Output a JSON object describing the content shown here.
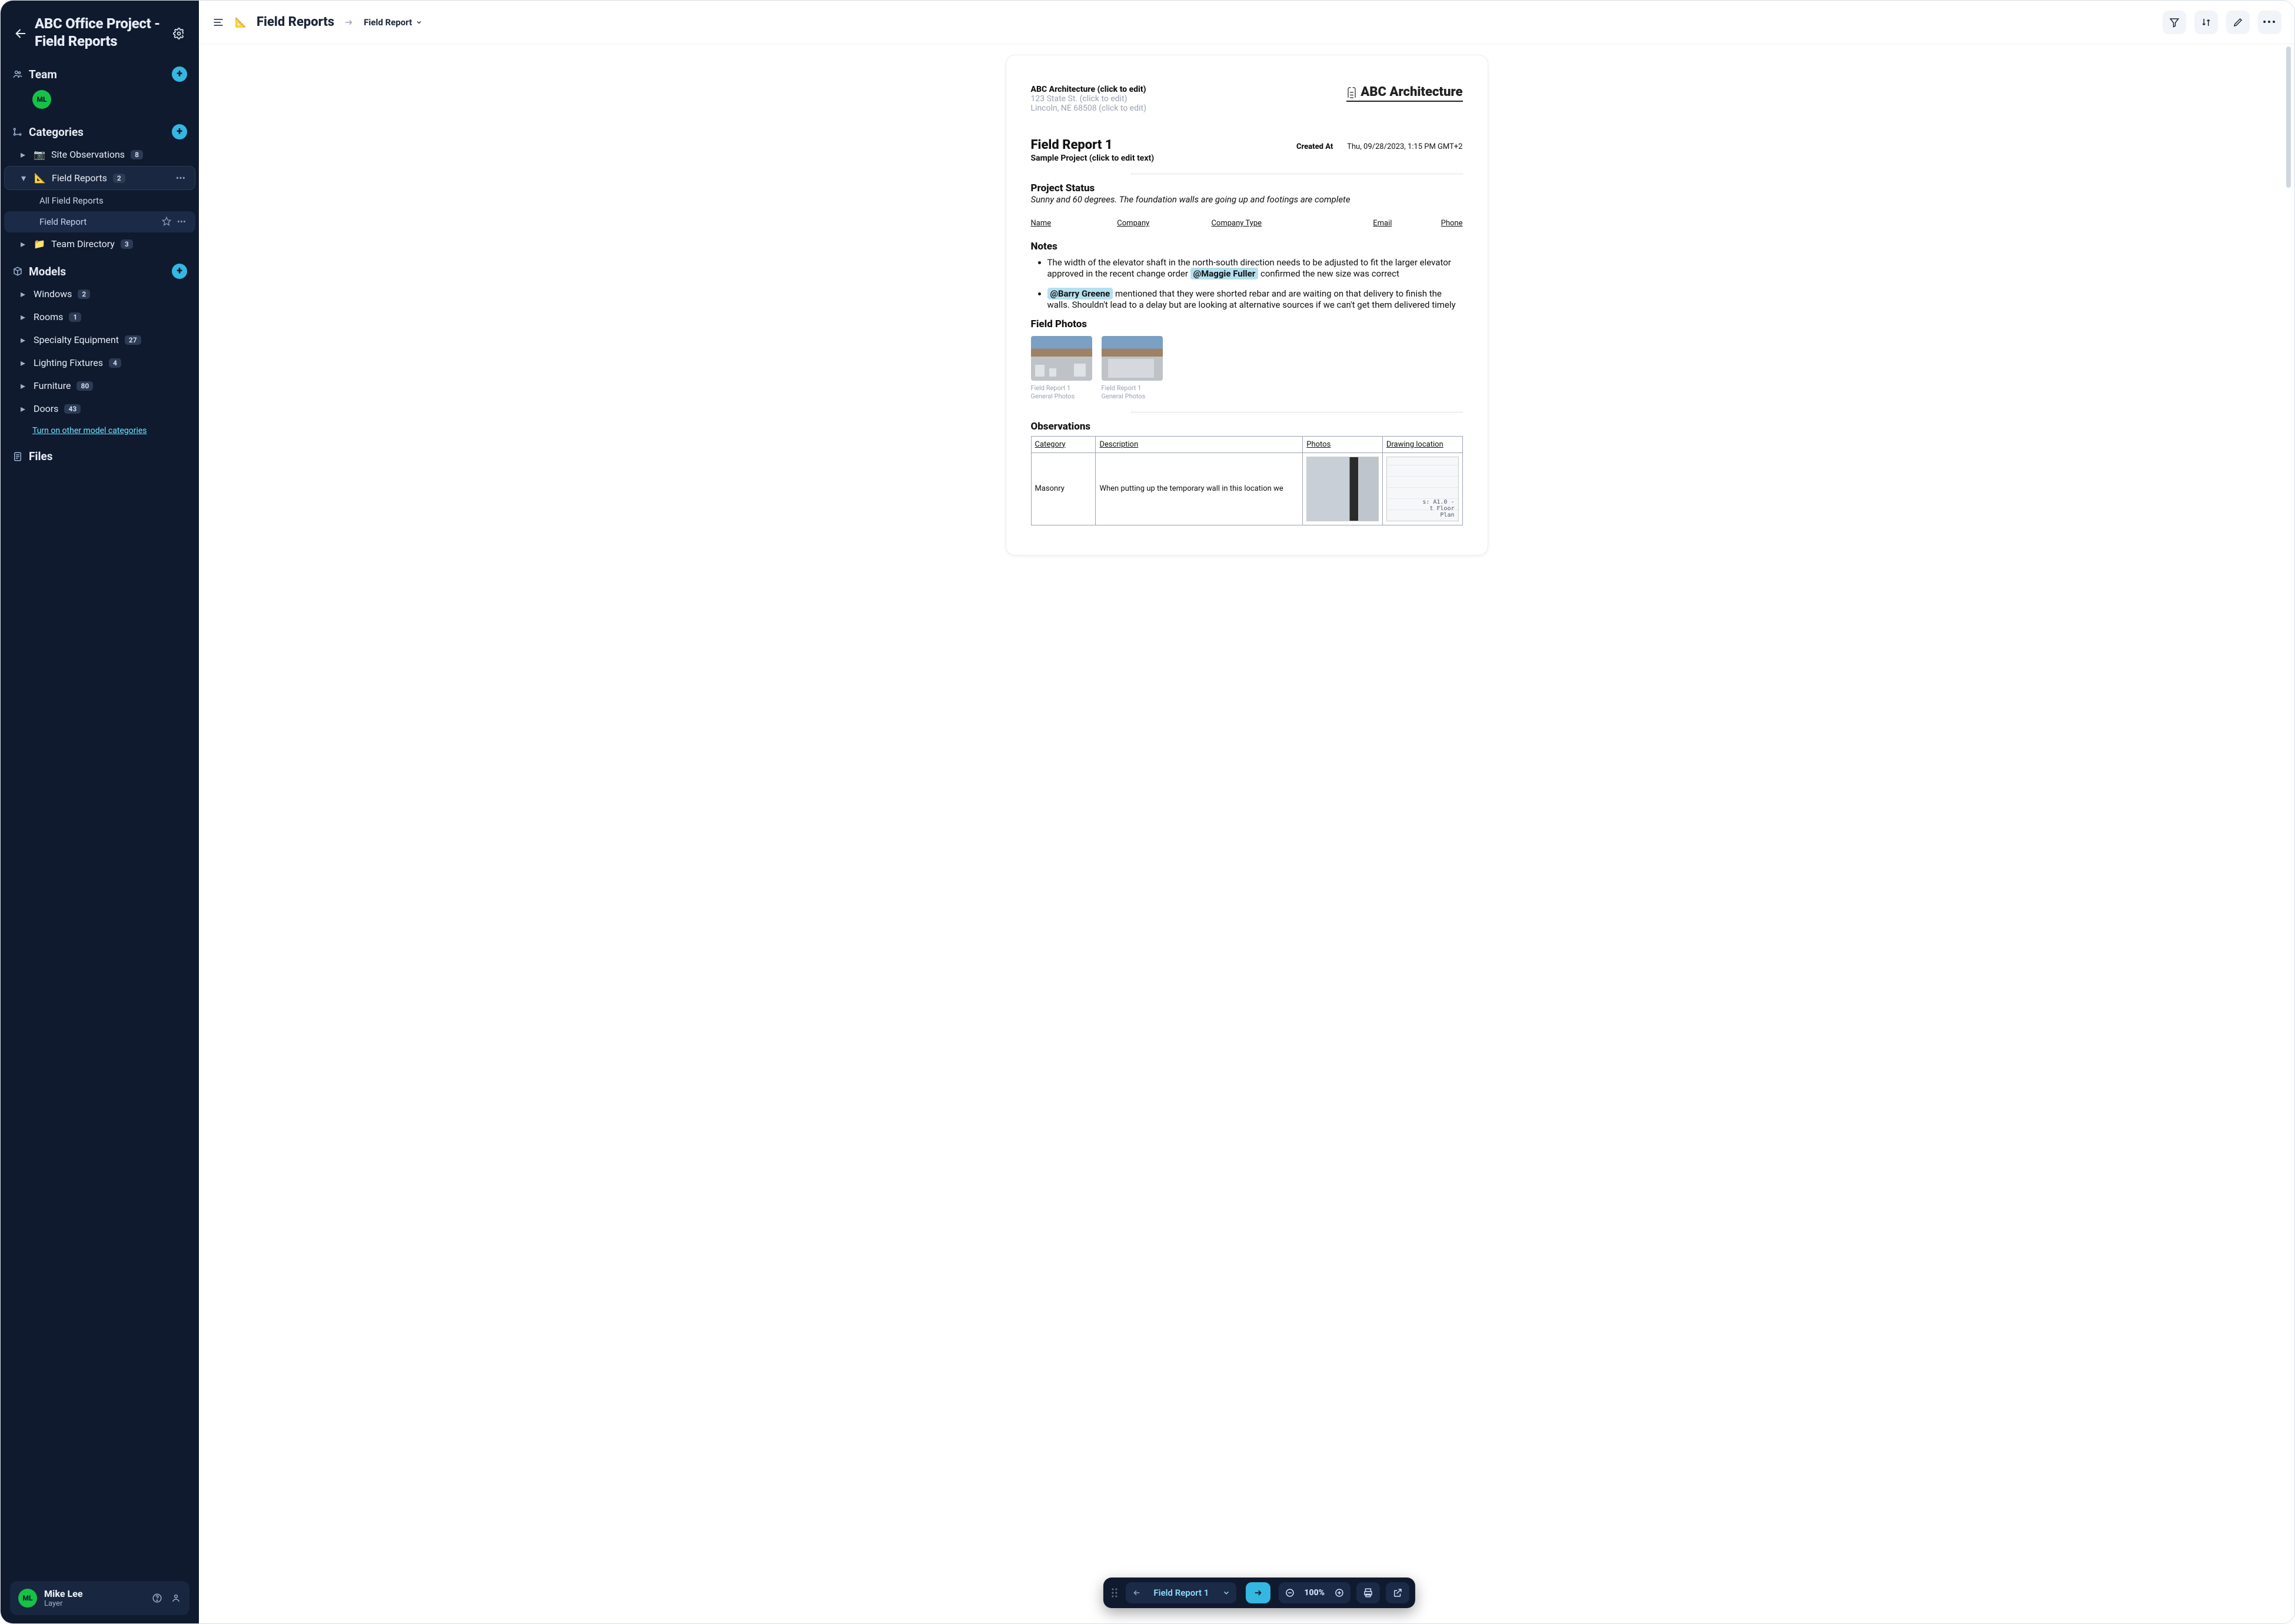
{
  "sidebar": {
    "back_label": "Back",
    "title": "ABC Office Project - Field Reports",
    "team": {
      "header": "Team",
      "members": [
        {
          "initials": "ML"
        }
      ]
    },
    "categories": {
      "header": "Categories",
      "items": [
        {
          "icon": "camera",
          "label": "Site Observations",
          "count": "8",
          "expanded": false
        },
        {
          "icon": "ruler",
          "label": "Field Reports",
          "count": "2",
          "expanded": true,
          "children": [
            {
              "label": "All Field Reports",
              "active": false
            },
            {
              "label": "Field Report",
              "active": true
            }
          ]
        },
        {
          "icon": "folder",
          "label": "Team Directory",
          "count": "3",
          "expanded": false
        }
      ]
    },
    "models": {
      "header": "Models",
      "items": [
        {
          "label": "Windows",
          "count": "2"
        },
        {
          "label": "Rooms",
          "count": "1"
        },
        {
          "label": "Specialty Equipment",
          "count": "27"
        },
        {
          "label": "Lighting Fixtures",
          "count": "4"
        },
        {
          "label": "Furniture",
          "count": "80"
        },
        {
          "label": "Doors",
          "count": "43"
        }
      ],
      "more_link": "Turn on other model categories"
    },
    "files_header": "Files",
    "user": {
      "initials": "ML",
      "name": "Mike Lee",
      "org": "Layer"
    }
  },
  "topbar": {
    "breadcrumb_root": "Field Reports",
    "breadcrumb_leaf": "Field Report"
  },
  "sheet": {
    "letterhead": {
      "company": "ABC Architecture (click to edit)",
      "addr1": "123 State St. (click to edit)",
      "addr2": "Lincoln, NE 68508 (click to edit)",
      "logo_text": "ABC Architecture"
    },
    "title": "Field Report 1",
    "subtitle": "Sample Project (click to edit text)",
    "created_label": "Created At",
    "created_value": "Thu, 09/28/2023, 1:15 PM GMT+2",
    "status_header": "Project Status",
    "status_body": "Sunny and 60 degrees. The foundation walls are going up and footings are complete",
    "attendee_cols": {
      "c1": "Name",
      "c2": "Company",
      "c3": "Company Type",
      "c4": "Email",
      "c5": "Phone"
    },
    "notes_header": "Notes",
    "notes": [
      {
        "pre": "The width of the elevator shaft in the north-south direction needs to be adjusted to fit the larger elevator approved in the recent change order ",
        "mention": "@Maggie Fuller",
        "post": " confirmed the new size was correct"
      },
      {
        "mention_first": "@Barry Greene",
        "post": " mentioned that they were shorted rebar and are waiting on that delivery to finish the walls. Shouldn't lead to a delay but are looking at alternative sources if we can't get them delivered timely"
      }
    ],
    "photos_header": "Field Photos",
    "photos": [
      {
        "caption_l1": "Field Report 1",
        "caption_l2": "General Photos"
      },
      {
        "caption_l1": "Field Report 1",
        "caption_l2": "General Photos"
      }
    ],
    "observations": {
      "header": "Observations",
      "cols": {
        "c1": "Category",
        "c2": "Description",
        "c3": "Photos",
        "c4": "Drawing location"
      },
      "rows": [
        {
          "category": "Masonry",
          "description": "When putting up the temporary wall in this location we",
          "drawing_label": "s: A1.0 -\nt Floor\nPlan"
        }
      ]
    }
  },
  "floatbar": {
    "selector_label": "Field Report 1",
    "zoom": "100%"
  },
  "colors": {
    "accent_teal": "#34b7e1",
    "mention_bg": "#b5e0f0",
    "avatar_green": "#16c147"
  }
}
